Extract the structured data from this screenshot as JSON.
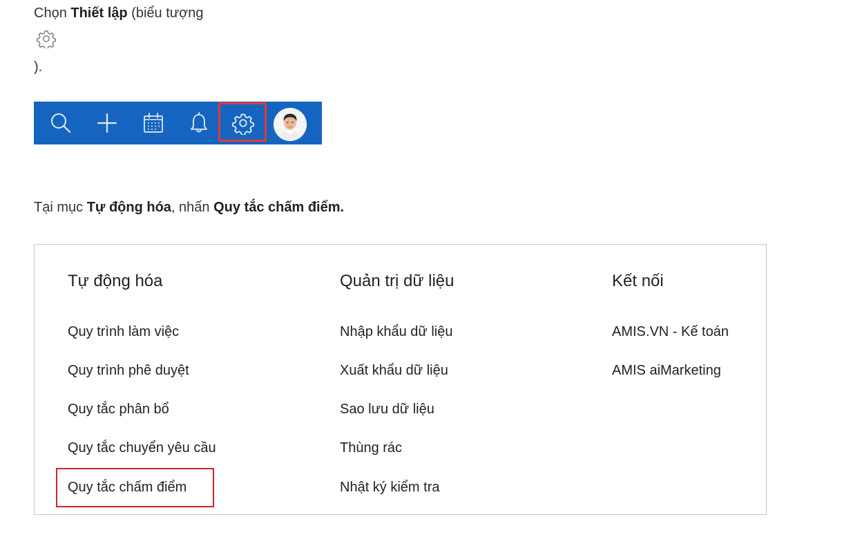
{
  "step1": {
    "prefix": "Chọn ",
    "bold": "Thiết lập",
    "suffix": " (biểu tượng",
    "icon": "gear-icon",
    "closing": ")."
  },
  "toolbar": {
    "background": "#1565c0",
    "highlight_color": "#e53935",
    "items": [
      {
        "icon": "search-icon"
      },
      {
        "icon": "plus-icon"
      },
      {
        "icon": "calendar-icon"
      },
      {
        "icon": "bell-icon"
      },
      {
        "icon": "gear-icon",
        "highlighted": true
      },
      {
        "icon": "avatar"
      }
    ]
  },
  "step2": {
    "prefix": "Tại mục ",
    "bold1": "Tự động hóa",
    "middle": ", nhấn ",
    "bold2": "Quy tắc chấm điểm."
  },
  "panel": {
    "highlight_color": "#c62828",
    "columns": [
      {
        "heading": "Tự động hóa",
        "items": [
          "Quy trình làm việc",
          "Quy trình phê duyệt",
          "Quy tắc phân bổ",
          "Quy tắc chuyển yêu cầu",
          "Quy tắc chấm điểm"
        ]
      },
      {
        "heading": "Quản trị dữ liệu",
        "items": [
          "Nhập khẩu dữ liệu",
          "Xuất khẩu dữ liệu",
          "Sao lưu dữ liệu",
          "Thùng rác",
          "Nhật ký kiểm tra"
        ]
      },
      {
        "heading": "Kết nối",
        "items": [
          "AMIS.VN - Kế toán",
          "AMIS aiMarketing"
        ]
      }
    ]
  }
}
